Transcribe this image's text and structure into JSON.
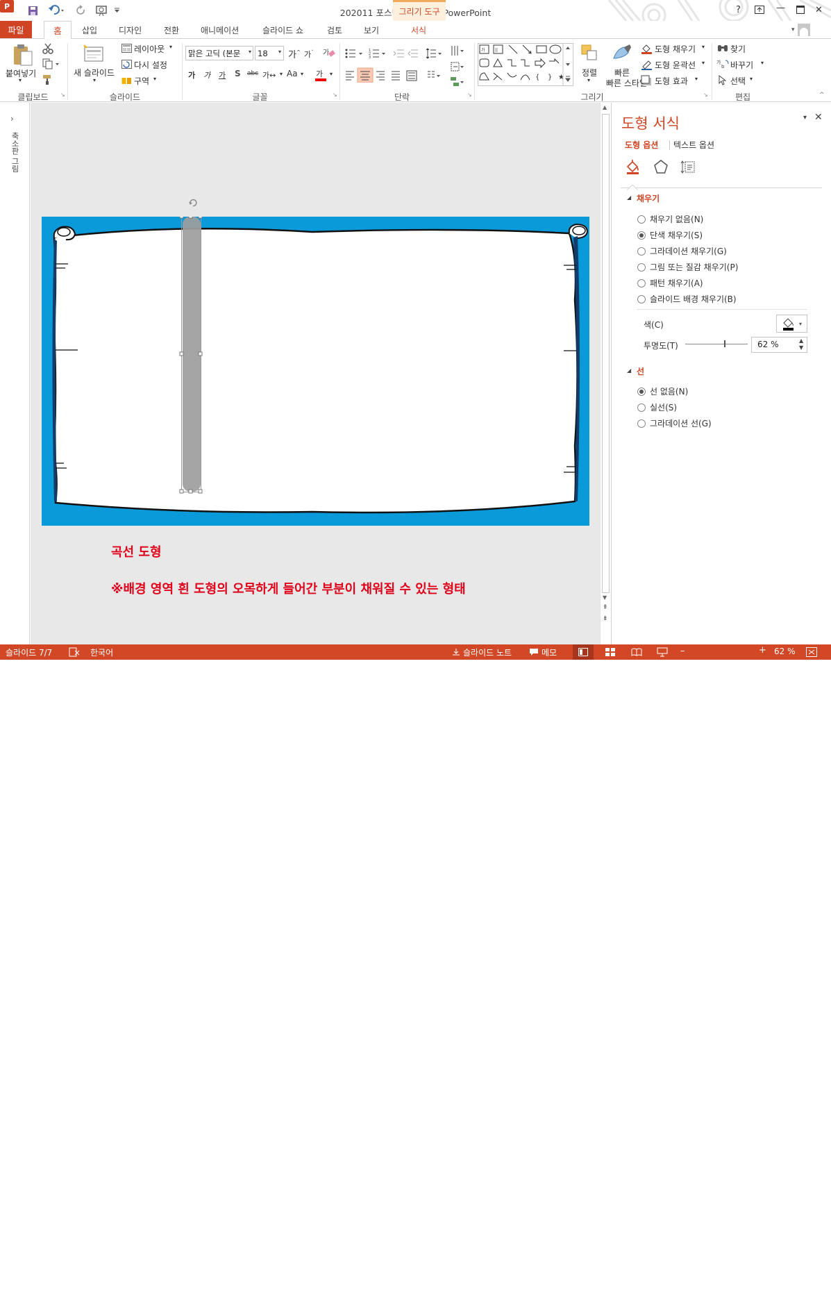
{
  "window": {
    "title": "202011 포스팅용 완성본 - PowerPoint",
    "context_group": "그리기 도구",
    "controls": {
      "help": "?",
      "minimize": "—",
      "close": "✕"
    }
  },
  "tabs": {
    "file": "파일",
    "home": "홈",
    "items": [
      "삽입",
      "디자인",
      "전환",
      "애니메이션",
      "슬라이드 쇼",
      "검토",
      "보기"
    ],
    "format": "서식"
  },
  "ribbon": {
    "clipboard": {
      "paste": "붙여넣기",
      "label": "클립보드"
    },
    "slides": {
      "new_slide": "새 슬라이드",
      "layout": "레이아웃",
      "reset": "다시 설정",
      "section": "구역",
      "label": "슬라이드"
    },
    "font": {
      "font_name": "맑은 고딕 (본문",
      "font_size": "18",
      "label": "글꼴"
    },
    "paragraph": {
      "label": "단락"
    },
    "drawing": {
      "arrange": "정렬",
      "quick_styles": "빠른 스타일",
      "shape_fill": "도형 채우기",
      "shape_outline": "도형 윤곽선",
      "shape_effects": "도형 효과",
      "label": "그리기"
    },
    "editing": {
      "find": "찾기",
      "replace": "바꾸기",
      "select": "선택",
      "label": "편집"
    }
  },
  "left_panel": {
    "label": "축소판 그림"
  },
  "slide": {
    "caption_title": "곡선 도형",
    "caption_note": "※배경 영역 흰 도형의 오목하게 들어간 부분이 채워질 수 있는 형태",
    "colors": {
      "background": "#0a9ad9",
      "scroll": "#ffffff",
      "selected_shape": "#9e9e9e",
      "caption": "#e0001a"
    }
  },
  "format_pane": {
    "title": "도형 서식",
    "tab_shape_options": "도형 옵션",
    "tab_text_options": "텍스트 옵션",
    "fill": {
      "header": "채우기",
      "options": [
        "채우기 없음(N)",
        "단색 채우기(S)",
        "그라데이션 채우기(G)",
        "그림 또는 질감 채우기(P)",
        "패턴 채우기(A)",
        "슬라이드 배경 채우기(B)"
      ],
      "selected": "단색 채우기(S)",
      "color_label": "색(C)",
      "transparency_label": "투명도(T)",
      "transparency_value": "62 %",
      "transparency_fraction": 0.62
    },
    "line": {
      "header": "선",
      "options": [
        "선 없음(N)",
        "실선(S)",
        "그라데이션 선(G)"
      ],
      "selected": "선 없음(N)"
    }
  },
  "status": {
    "slide": "슬라이드 7/7",
    "language": "한국어",
    "notes": "슬라이드 노트",
    "comments": "메모",
    "zoom": "62 %",
    "zoom_fraction": 0.62
  }
}
